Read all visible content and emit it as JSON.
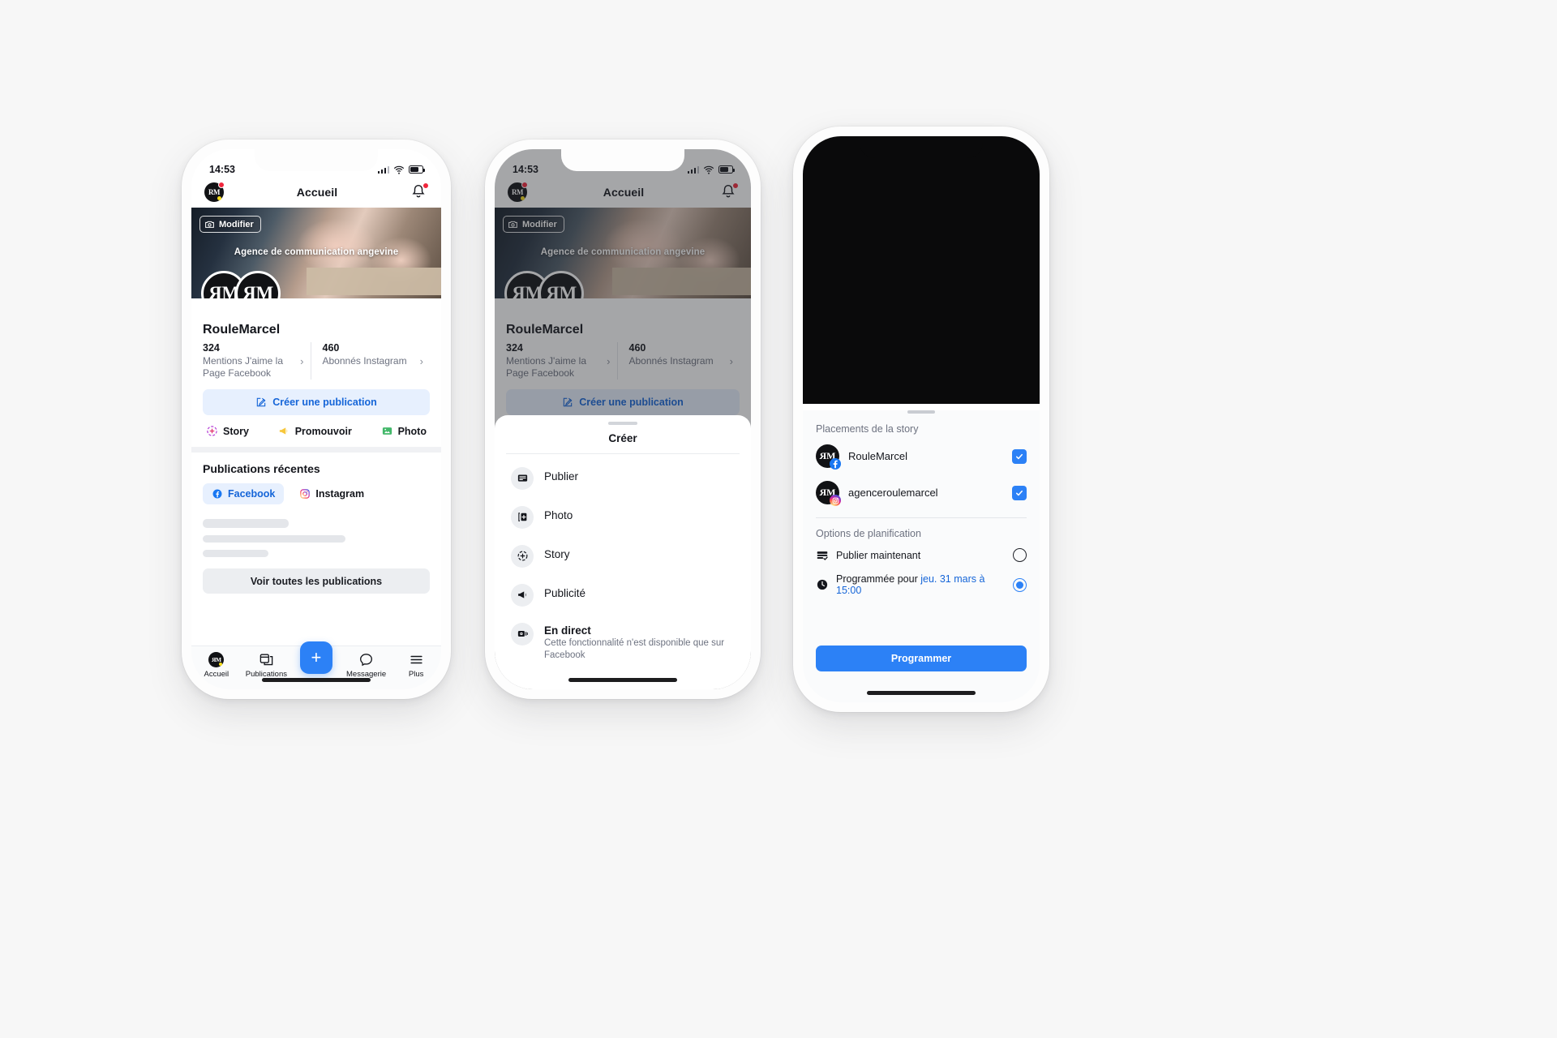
{
  "status_bar": {
    "time": "14:53"
  },
  "phone1": {
    "nav": {
      "title": "Accueil",
      "avatar_initials": "RM",
      "bell_icon": "bell-icon"
    },
    "cover": {
      "edit_label": "Modifier",
      "overlay_text": "Agence de communication angevine"
    },
    "profile": {
      "name": "RouleMarcel",
      "stats": [
        {
          "value": "324",
          "label": "Mentions J'aime la Page Facebook"
        },
        {
          "value": "460",
          "label": "Abonnés Instagram"
        }
      ],
      "create_post_label": "Créer une publication"
    },
    "quick_actions": [
      {
        "label": "Story",
        "icon": "story-plus-icon"
      },
      {
        "label": "Promouvoir",
        "icon": "megaphone-icon"
      },
      {
        "label": "Photo",
        "icon": "photo-icon"
      }
    ],
    "recent": {
      "title": "Publications récentes",
      "tabs": [
        {
          "label": "Facebook",
          "icon": "facebook-icon",
          "active": true
        },
        {
          "label": "Instagram",
          "icon": "instagram-icon",
          "active": false
        }
      ],
      "see_all_label": "Voir toutes les publications"
    },
    "tabbar": [
      {
        "label": "Accueil",
        "icon": "profile-avatar-icon"
      },
      {
        "label": "Publications",
        "icon": "posts-icon"
      },
      {
        "label": "",
        "icon": "plus-fab-icon"
      },
      {
        "label": "Messagerie",
        "icon": "chat-bubble-icon"
      },
      {
        "label": "Plus",
        "icon": "hamburger-icon"
      }
    ]
  },
  "phone2": {
    "sheet": {
      "title": "Créer",
      "items": [
        {
          "label": "Publier",
          "icon": "post-card-icon",
          "sub": ""
        },
        {
          "label": "Photo",
          "icon": "photo-add-icon",
          "sub": ""
        },
        {
          "label": "Story",
          "icon": "story-plus-icon",
          "sub": ""
        },
        {
          "label": "Publicité",
          "icon": "megaphone-icon",
          "sub": ""
        },
        {
          "label": "En direct",
          "icon": "live-video-icon",
          "sub": "Cette fonctionnalité n'est disponible que sur Facebook"
        }
      ]
    }
  },
  "phone3": {
    "placements_title": "Placements de la story",
    "placements": [
      {
        "name": "RouleMarcel",
        "network": "facebook",
        "checked": true
      },
      {
        "name": "agenceroulemarcel",
        "network": "instagram",
        "checked": true
      }
    ],
    "schedule_title": "Options de planification",
    "options": [
      {
        "label": "Publier maintenant",
        "icon": "publish-now-icon",
        "selected": false,
        "link": ""
      },
      {
        "label": "Programmée pour ",
        "icon": "clock-icon",
        "selected": true,
        "link": "jeu. 31 mars à 15:00"
      }
    ],
    "cta_label": "Programmer"
  },
  "colors": {
    "accent_blue": "#2c81f6",
    "link_blue": "#1565d8",
    "chip_blue_bg": "#e7f0fe",
    "facebook": "#1877f2",
    "notification_red": "#f0263c",
    "brand_yellow": "#f5dd1e"
  }
}
